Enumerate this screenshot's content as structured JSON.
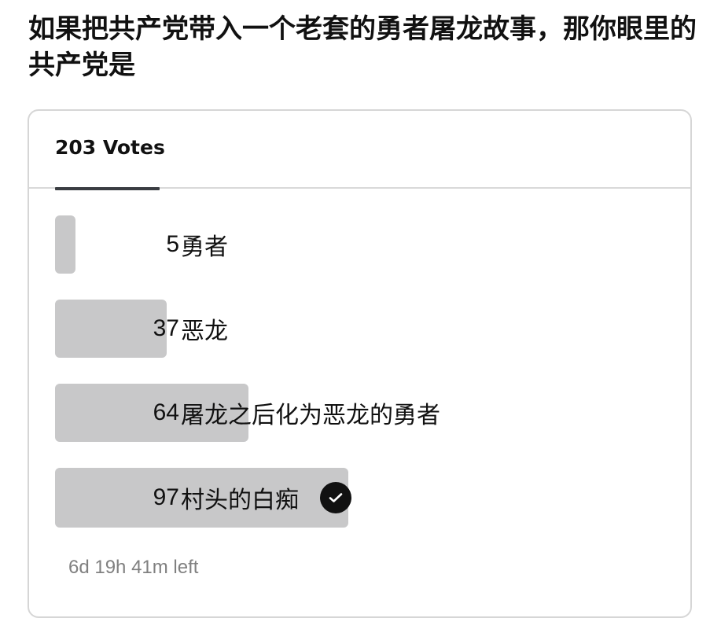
{
  "question": "如果把共产党带入一个老套的勇者屠龙故事，那你眼里的共产党是",
  "poll": {
    "vote_tab_label": "203 Votes",
    "options": [
      {
        "count": "5",
        "label": "勇者",
        "votes": 5,
        "selected": false
      },
      {
        "count": "37",
        "label": "恶龙",
        "votes": 37,
        "selected": false
      },
      {
        "count": "64",
        "label": "屠龙之后化为恶龙的勇者",
        "votes": 64,
        "selected": false
      },
      {
        "count": "97",
        "label": "村头的白痴",
        "votes": 97,
        "selected": true
      }
    ],
    "time_left": "6d 19h 41m left",
    "selected_icon": "checkmark-icon"
  },
  "colors": {
    "bar": "#c8c8c9",
    "text": "#111111",
    "muted": "#808080",
    "tab_underline": "#3a3d42"
  }
}
